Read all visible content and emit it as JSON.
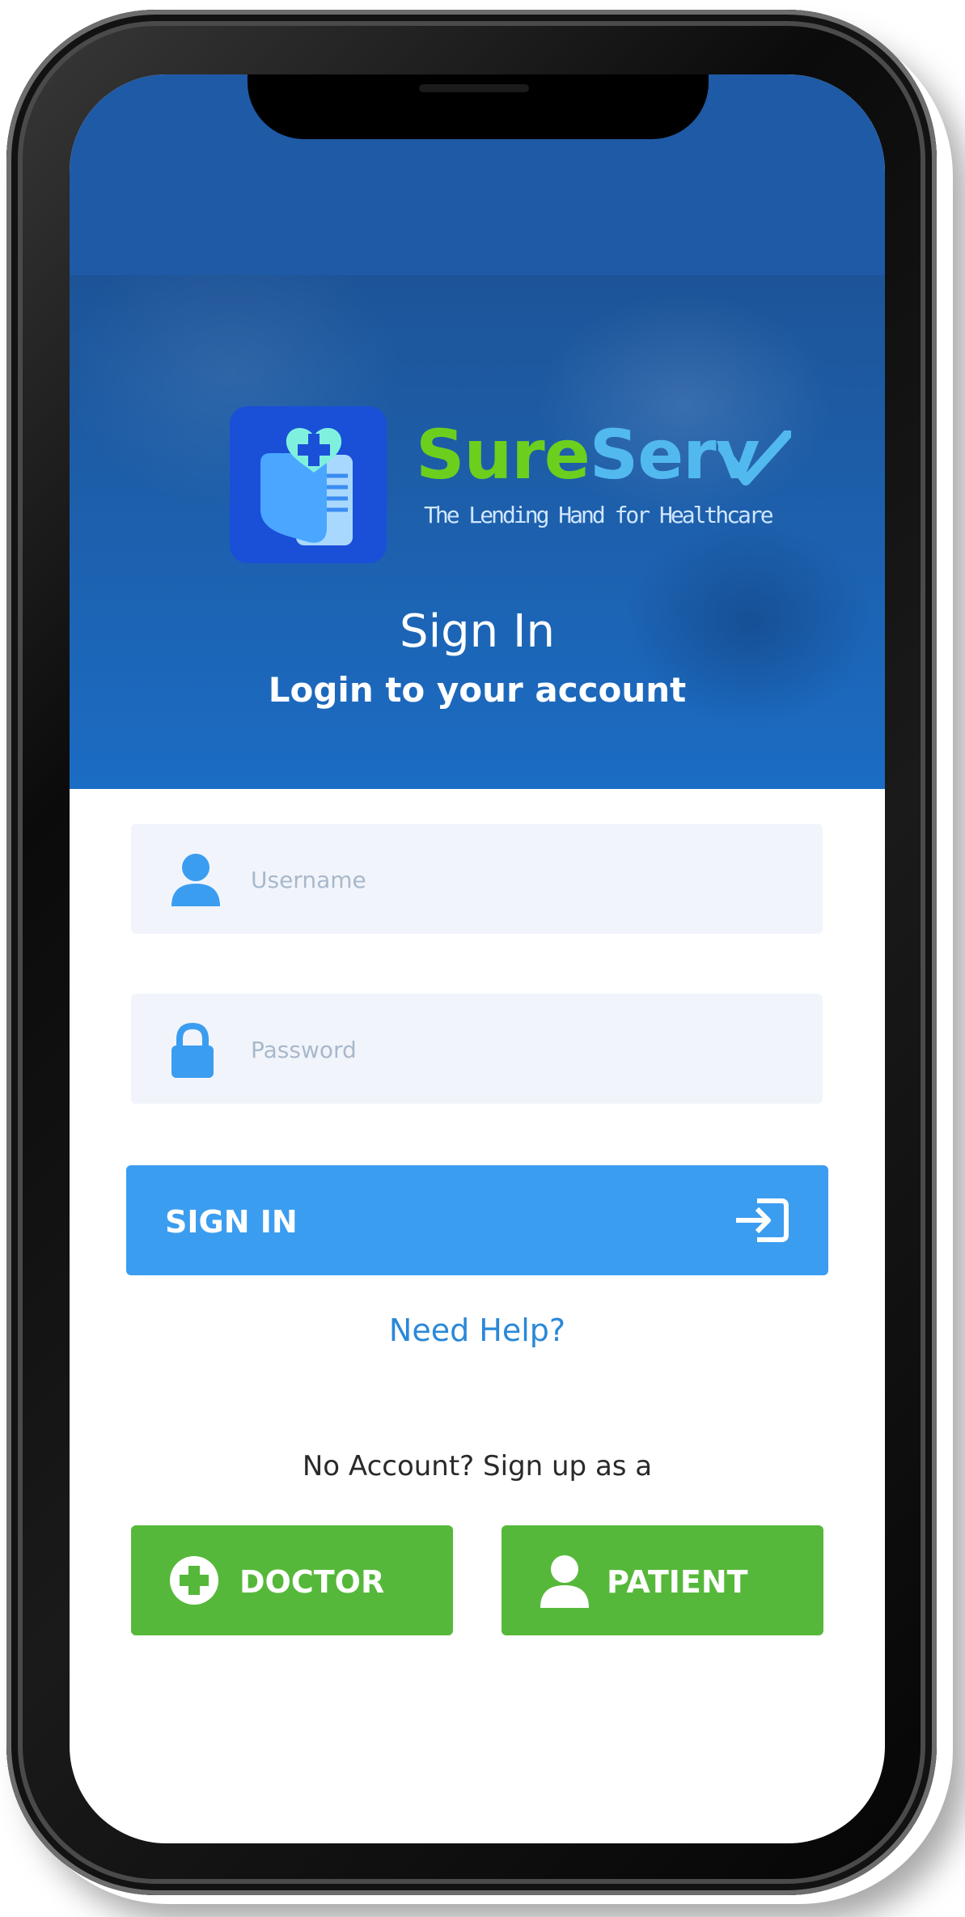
{
  "brand": {
    "part1": "Sure",
    "part2": "Serv",
    "tagline": "The Lending Hand for Healthcare"
  },
  "header": {
    "title": "Sign In",
    "subtitle": "Login to your account"
  },
  "form": {
    "username_placeholder": "Username",
    "password_placeholder": "Password",
    "signin_label": "SIGN IN",
    "help_link": "Need Help?"
  },
  "signup": {
    "prompt": "No Account? Sign up as a",
    "doctor_label": "DOCTOR",
    "patient_label": "PATIENT"
  },
  "colors": {
    "primary": "#3b9df0",
    "header_blue": "#1f5aa6",
    "accent_green": "#56b83a",
    "link_blue": "#2a88d8"
  },
  "icons": [
    "user-icon",
    "lock-icon",
    "login-arrow-icon",
    "plus-circle-icon",
    "person-icon",
    "heart-cross-icon"
  ]
}
